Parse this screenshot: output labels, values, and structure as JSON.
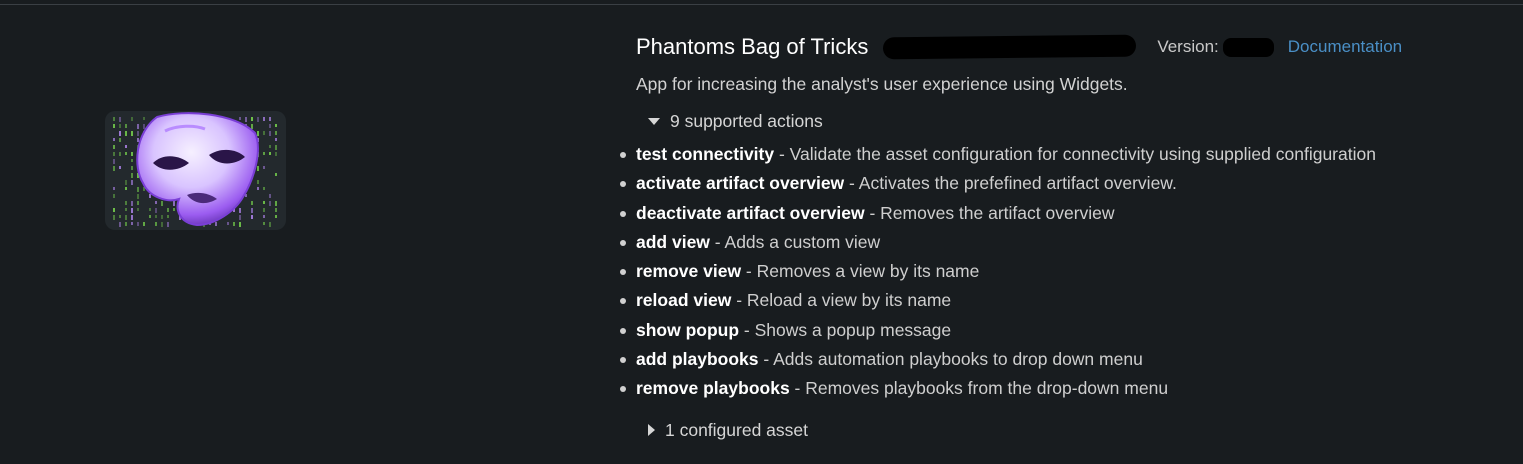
{
  "app": {
    "title": "Phantoms Bag of Tricks",
    "version_label": "Version:",
    "documentation_link": "Documentation",
    "description": "App for increasing the analyst's user experience using Widgets.",
    "logo_icon": "theater-mask-icon"
  },
  "actions_section": {
    "label": "9 supported actions",
    "expanded": true,
    "items": [
      {
        "name": "test connectivity",
        "sep": " - ",
        "desc": "Validate the asset configuration for connectivity using supplied configuration"
      },
      {
        "name": "activate artifact overview",
        "sep": " - ",
        "desc": "Activates the prefefined artifact overview."
      },
      {
        "name": "deactivate artifact overview",
        "sep": " - ",
        "desc": "Removes the artifact overview"
      },
      {
        "name": "add view",
        "sep": " - ",
        "desc": "Adds a custom view"
      },
      {
        "name": "remove view",
        "sep": " - ",
        "desc": "Removes a view by its name"
      },
      {
        "name": "reload view",
        "sep": " - ",
        "desc": "Reload a view by its name"
      },
      {
        "name": "show popup",
        "sep": " - ",
        "desc": "Shows a popup message"
      },
      {
        "name": "add playbooks",
        "sep": " - ",
        "desc": "Adds automation playbooks to drop down menu"
      },
      {
        "name": "remove playbooks",
        "sep": " - ",
        "desc": "Removes playbooks from the drop-down menu"
      }
    ]
  },
  "assets_section": {
    "label": "1 configured asset",
    "expanded": false
  },
  "colors": {
    "background": "#181c1f",
    "link": "#4a8fc6",
    "mask_purple": "#9b5cf0",
    "matrix_green": "#6fc24a"
  }
}
